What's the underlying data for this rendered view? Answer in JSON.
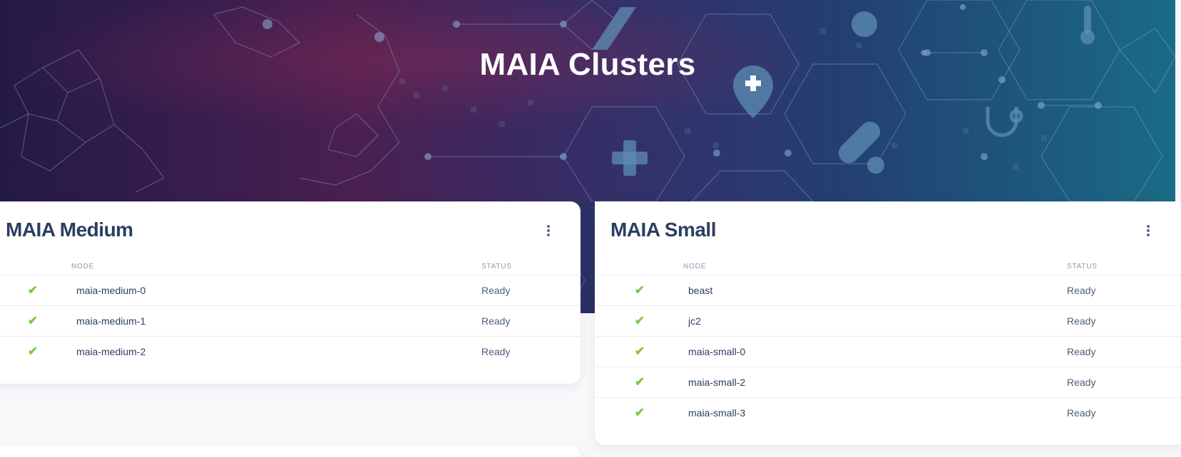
{
  "header": {
    "title": "MAIA Clusters"
  },
  "clusters": [
    {
      "title": "MAIA Medium",
      "columns": {
        "node": "NODE",
        "status": "STATUS"
      },
      "rows": [
        {
          "status_icon": "check-icon",
          "node": "maia-medium-0",
          "status": "Ready"
        },
        {
          "status_icon": "check-icon",
          "node": "maia-medium-1",
          "status": "Ready"
        },
        {
          "status_icon": "check-icon",
          "node": "maia-medium-2",
          "status": "Ready"
        }
      ]
    },
    {
      "title": "MAIA Small",
      "columns": {
        "node": "NODE",
        "status": "STATUS"
      },
      "rows": [
        {
          "status_icon": "check-icon",
          "node": "beast",
          "status": "Ready"
        },
        {
          "status_icon": "check-icon",
          "node": "jc2",
          "status": "Ready"
        },
        {
          "status_icon": "check-icon",
          "node": "maia-small-0",
          "status": "Ready"
        },
        {
          "status_icon": "check-icon",
          "node": "maia-small-2",
          "status": "Ready"
        },
        {
          "status_icon": "check-icon",
          "node": "maia-small-3",
          "status": "Ready"
        }
      ]
    }
  ],
  "colors": {
    "check": "#7ac943",
    "title": "#2c3e61",
    "status_text": "#4d5e7c",
    "header_text": "#8c98ad"
  },
  "icons": {
    "kebab": "more-vertical-icon",
    "ready": "check-icon"
  }
}
